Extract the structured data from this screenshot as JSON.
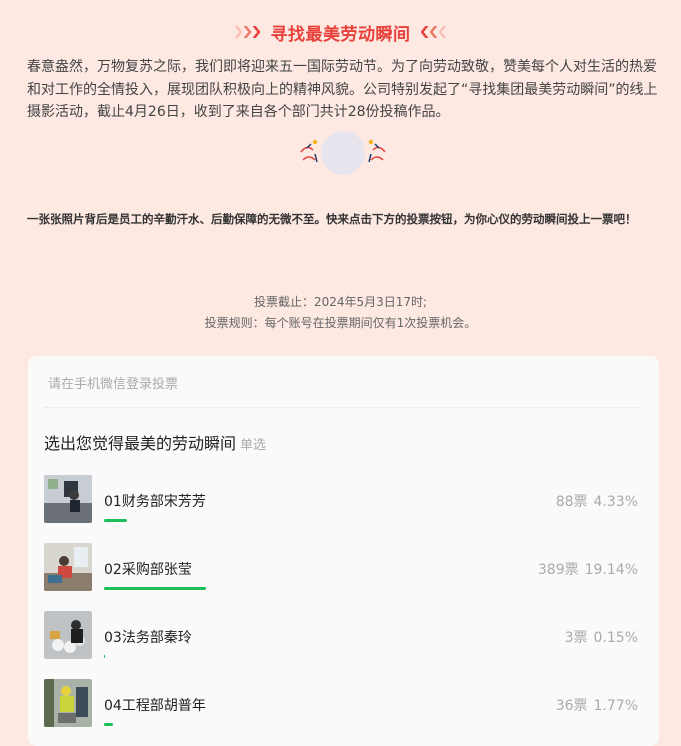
{
  "header": {
    "title": "寻找最美劳动瞬间",
    "accent_color": "#e8413a",
    "chevron_colors": [
      "#f9c0b5",
      "#f07a6a",
      "#e8413a"
    ]
  },
  "intro_text": "春意盎然，万物复苏之际，我们即将迎来五一国际劳动节。为了向劳动致敬，赞美每个人对生活的热爱和对工作的全情投入，展现团队积极向上的精神风貌。公司特别发起了“寻找集团最美劳动瞬间”的线上摄影活动，截止4月26日，收到了来自各个部门共计28份投稿作品。",
  "bold_note": "一张张照片背后是员工的辛勤汗水、后勤保障的无微不至。快来点击下方的投票按钮，为你心仪的劳动瞬间投上一票吧！",
  "vote_info": {
    "deadline": "投票截止：2024年5月3日17时;",
    "rules": "投票规则：每个账号在投票期间仅有1次投票机会。"
  },
  "vote_card": {
    "login_hint": "请在手机微信登录投票",
    "question": "选出您觉得最美的劳动瞬间",
    "question_type": "单选",
    "bar_color": "#1dbf5a",
    "options": [
      {
        "label": "01财务部宋芳芳",
        "votes": "88票",
        "percent": "4.33%",
        "share": 0.0433
      },
      {
        "label": "02采购部张莹",
        "votes": "389票",
        "percent": "19.14%",
        "share": 0.1914
      },
      {
        "label": "03法务部秦玲",
        "votes": "3票",
        "percent": "0.15%",
        "share": 0.0015
      },
      {
        "label": "04工程部胡普年",
        "votes": "36票",
        "percent": "1.77%",
        "share": 0.0177
      }
    ]
  }
}
